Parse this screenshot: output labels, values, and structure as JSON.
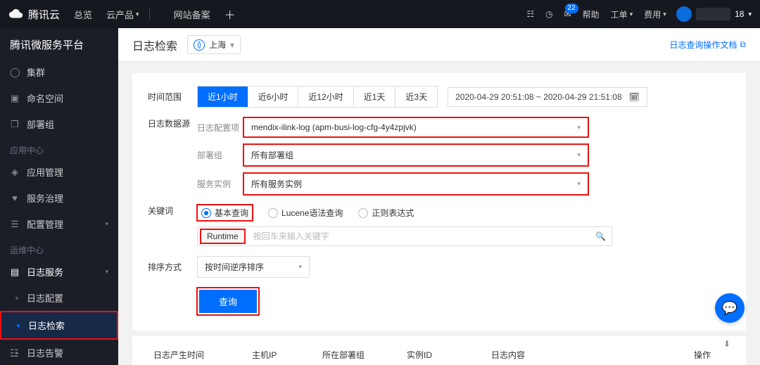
{
  "topbar": {
    "brand": "腾讯云",
    "nav_overview": "总览",
    "nav_products": "云产品",
    "nav_beian": "网站备案",
    "msg_badge": "22",
    "help": "帮助",
    "ticket": "工单",
    "billing": "费用",
    "user_suffix": "18"
  },
  "sidebar": {
    "title": "腾讯微服务平台",
    "items": {
      "cluster": "集群",
      "namespace": "命名空间",
      "deploy_group": "部署组"
    },
    "section_app": "应用中心",
    "app_mgmt": "应用管理",
    "svc_gov": "服务治理",
    "cfg_mgmt": "配置管理",
    "section_ops": "运维中心",
    "log_service": "日志服务",
    "log_config": "日志配置",
    "log_search": "日志检索",
    "log_alarm": "日志告警"
  },
  "header": {
    "title": "日志检索",
    "region": "上海",
    "doc_link": "日志查询操作文档"
  },
  "form": {
    "time_label": "时间范围",
    "time_presets": [
      "近1小时",
      "近6小时",
      "近12小时",
      "近1天",
      "近3天"
    ],
    "time_active": 0,
    "datetime_range": "2020-04-29 20:51:08 ~ 2020-04-29 21:51:08",
    "datasource_label": "日志数据源",
    "config_label": "日志配置项",
    "config_value": "mendix-ilink-log (apm-busi-log-cfg-4y4zpjvk)",
    "group_label": "部署组",
    "group_value": "所有部署组",
    "instance_label": "服务实例",
    "instance_value": "所有服务实例",
    "keyword_label": "关键词",
    "query_modes": {
      "basic": "基本查询",
      "lucene": "Lucene语法查询",
      "regex": "正则表达式"
    },
    "kw_tag": "Runtime",
    "kw_placeholder": "按回车来输入关键字",
    "sort_label": "排序方式",
    "sort_value": "按时间逆序排序",
    "submit": "查询"
  },
  "table": {
    "col_time": "日志产生时间",
    "col_ip": "主机IP",
    "col_group": "所在部署组",
    "col_instance": "实例ID",
    "col_content": "日志内容",
    "col_op": "操作"
  }
}
